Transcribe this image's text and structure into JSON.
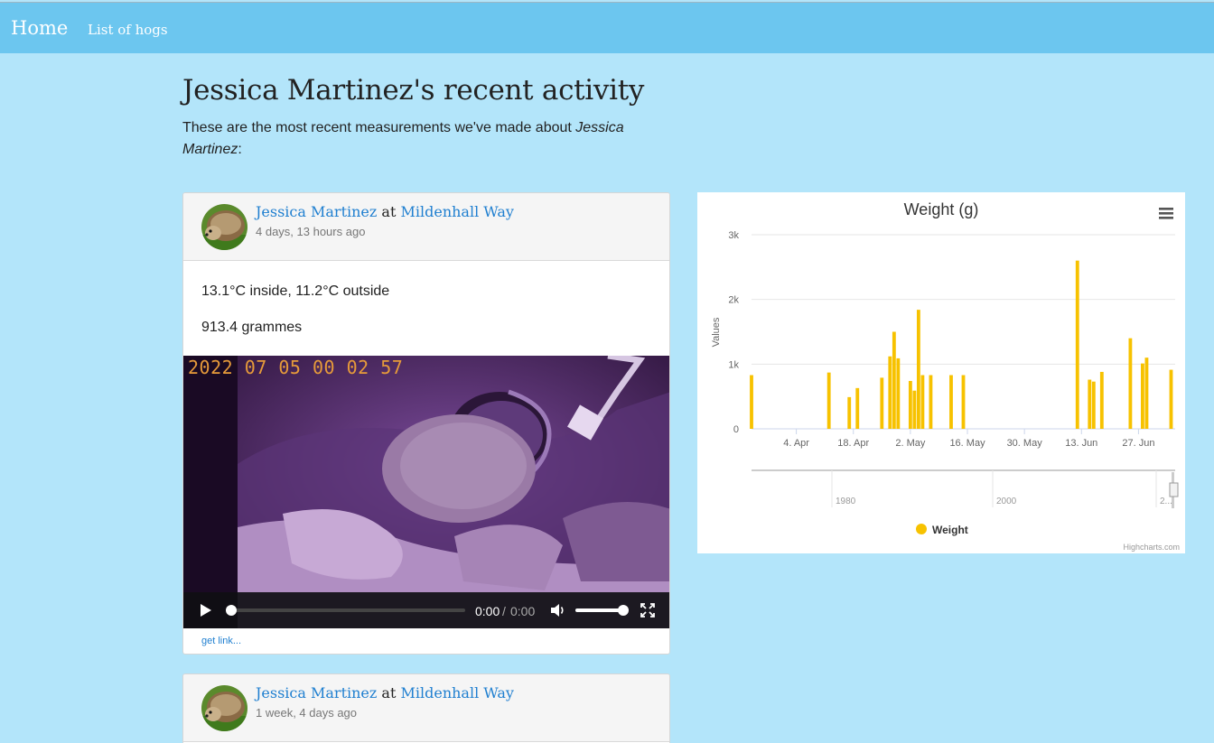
{
  "nav": {
    "home": "Home",
    "list_of_hogs": "List of hogs"
  },
  "page": {
    "title": "Jessica Martinez's recent activity",
    "intro_prefix": "These are the most recent measurements we've made about ",
    "intro_name": "Jessica Martinez",
    "intro_suffix": ":"
  },
  "entries": [
    {
      "hog": "Jessica Martinez",
      "at": "at",
      "location": "Mildenhall Way",
      "time_ago": "4 days, 13 hours ago",
      "temperature": "13.1°C inside, 11.2°C outside",
      "weight": "913.4 grammes",
      "video": {
        "timestamp": "2022 07 05 00 02 57",
        "current_time": "0:00",
        "separator": "/",
        "duration": "0:00",
        "progress": 0,
        "volume": 1.0
      },
      "link": "get link..."
    },
    {
      "hog": "Jessica Martinez",
      "at": "at",
      "location": "Mildenhall Way",
      "time_ago": "1 week, 4 days ago"
    }
  ],
  "icons": {
    "menu": "hamburger-icon",
    "play": "play-icon",
    "volume": "volume-icon",
    "fullscreen": "fullscreen-icon",
    "avatar": "hedgehog-avatar"
  },
  "colors": {
    "nav": "#6cc6ef",
    "background": "#b3e5fa",
    "bar": "#f7c200",
    "link": "#1f7fd0"
  },
  "chart_data": {
    "type": "bar",
    "title": "Weight (g)",
    "ylabel": "Values",
    "ylim": [
      0,
      3000
    ],
    "yticks": [
      0,
      1000,
      2000,
      3000
    ],
    "ytick_labels": [
      "0",
      "1k",
      "2k",
      "3k"
    ],
    "xlim": [
      "2022-03-24",
      "2022-07-06"
    ],
    "xticks": [
      "2022-04-04",
      "2022-04-18",
      "2022-05-02",
      "2022-05-16",
      "2022-05-30",
      "2022-06-13",
      "2022-06-27"
    ],
    "xtick_labels": [
      "4. Apr",
      "18. Apr",
      "2. May",
      "16. May",
      "30. May",
      "13. Jun",
      "27. Jun"
    ],
    "series": [
      {
        "name": "Weight",
        "color": "#f7c200",
        "points": [
          [
            "2022-03-24",
            830
          ],
          [
            "2022-04-12",
            870
          ],
          [
            "2022-04-17",
            490
          ],
          [
            "2022-04-19",
            630
          ],
          [
            "2022-04-25",
            790
          ],
          [
            "2022-04-27",
            1120
          ],
          [
            "2022-04-28",
            1500
          ],
          [
            "2022-04-29",
            1090
          ],
          [
            "2022-05-02",
            740
          ],
          [
            "2022-05-03",
            590
          ],
          [
            "2022-05-04",
            1840
          ],
          [
            "2022-05-05",
            830
          ],
          [
            "2022-05-07",
            830
          ],
          [
            "2022-05-12",
            830
          ],
          [
            "2022-05-15",
            830
          ],
          [
            "2022-06-12",
            2600
          ],
          [
            "2022-06-15",
            760
          ],
          [
            "2022-06-16",
            730
          ],
          [
            "2022-06-18",
            880
          ],
          [
            "2022-06-25",
            1400
          ],
          [
            "2022-06-28",
            1010
          ],
          [
            "2022-06-29",
            1100
          ],
          [
            "2022-07-05",
            913
          ]
        ]
      }
    ],
    "navigator": {
      "labels": [
        "1980",
        "2000",
        "2..."
      ]
    },
    "legend": {
      "position": "bottom-center"
    },
    "credits": "Highcharts.com",
    "grid": true
  }
}
